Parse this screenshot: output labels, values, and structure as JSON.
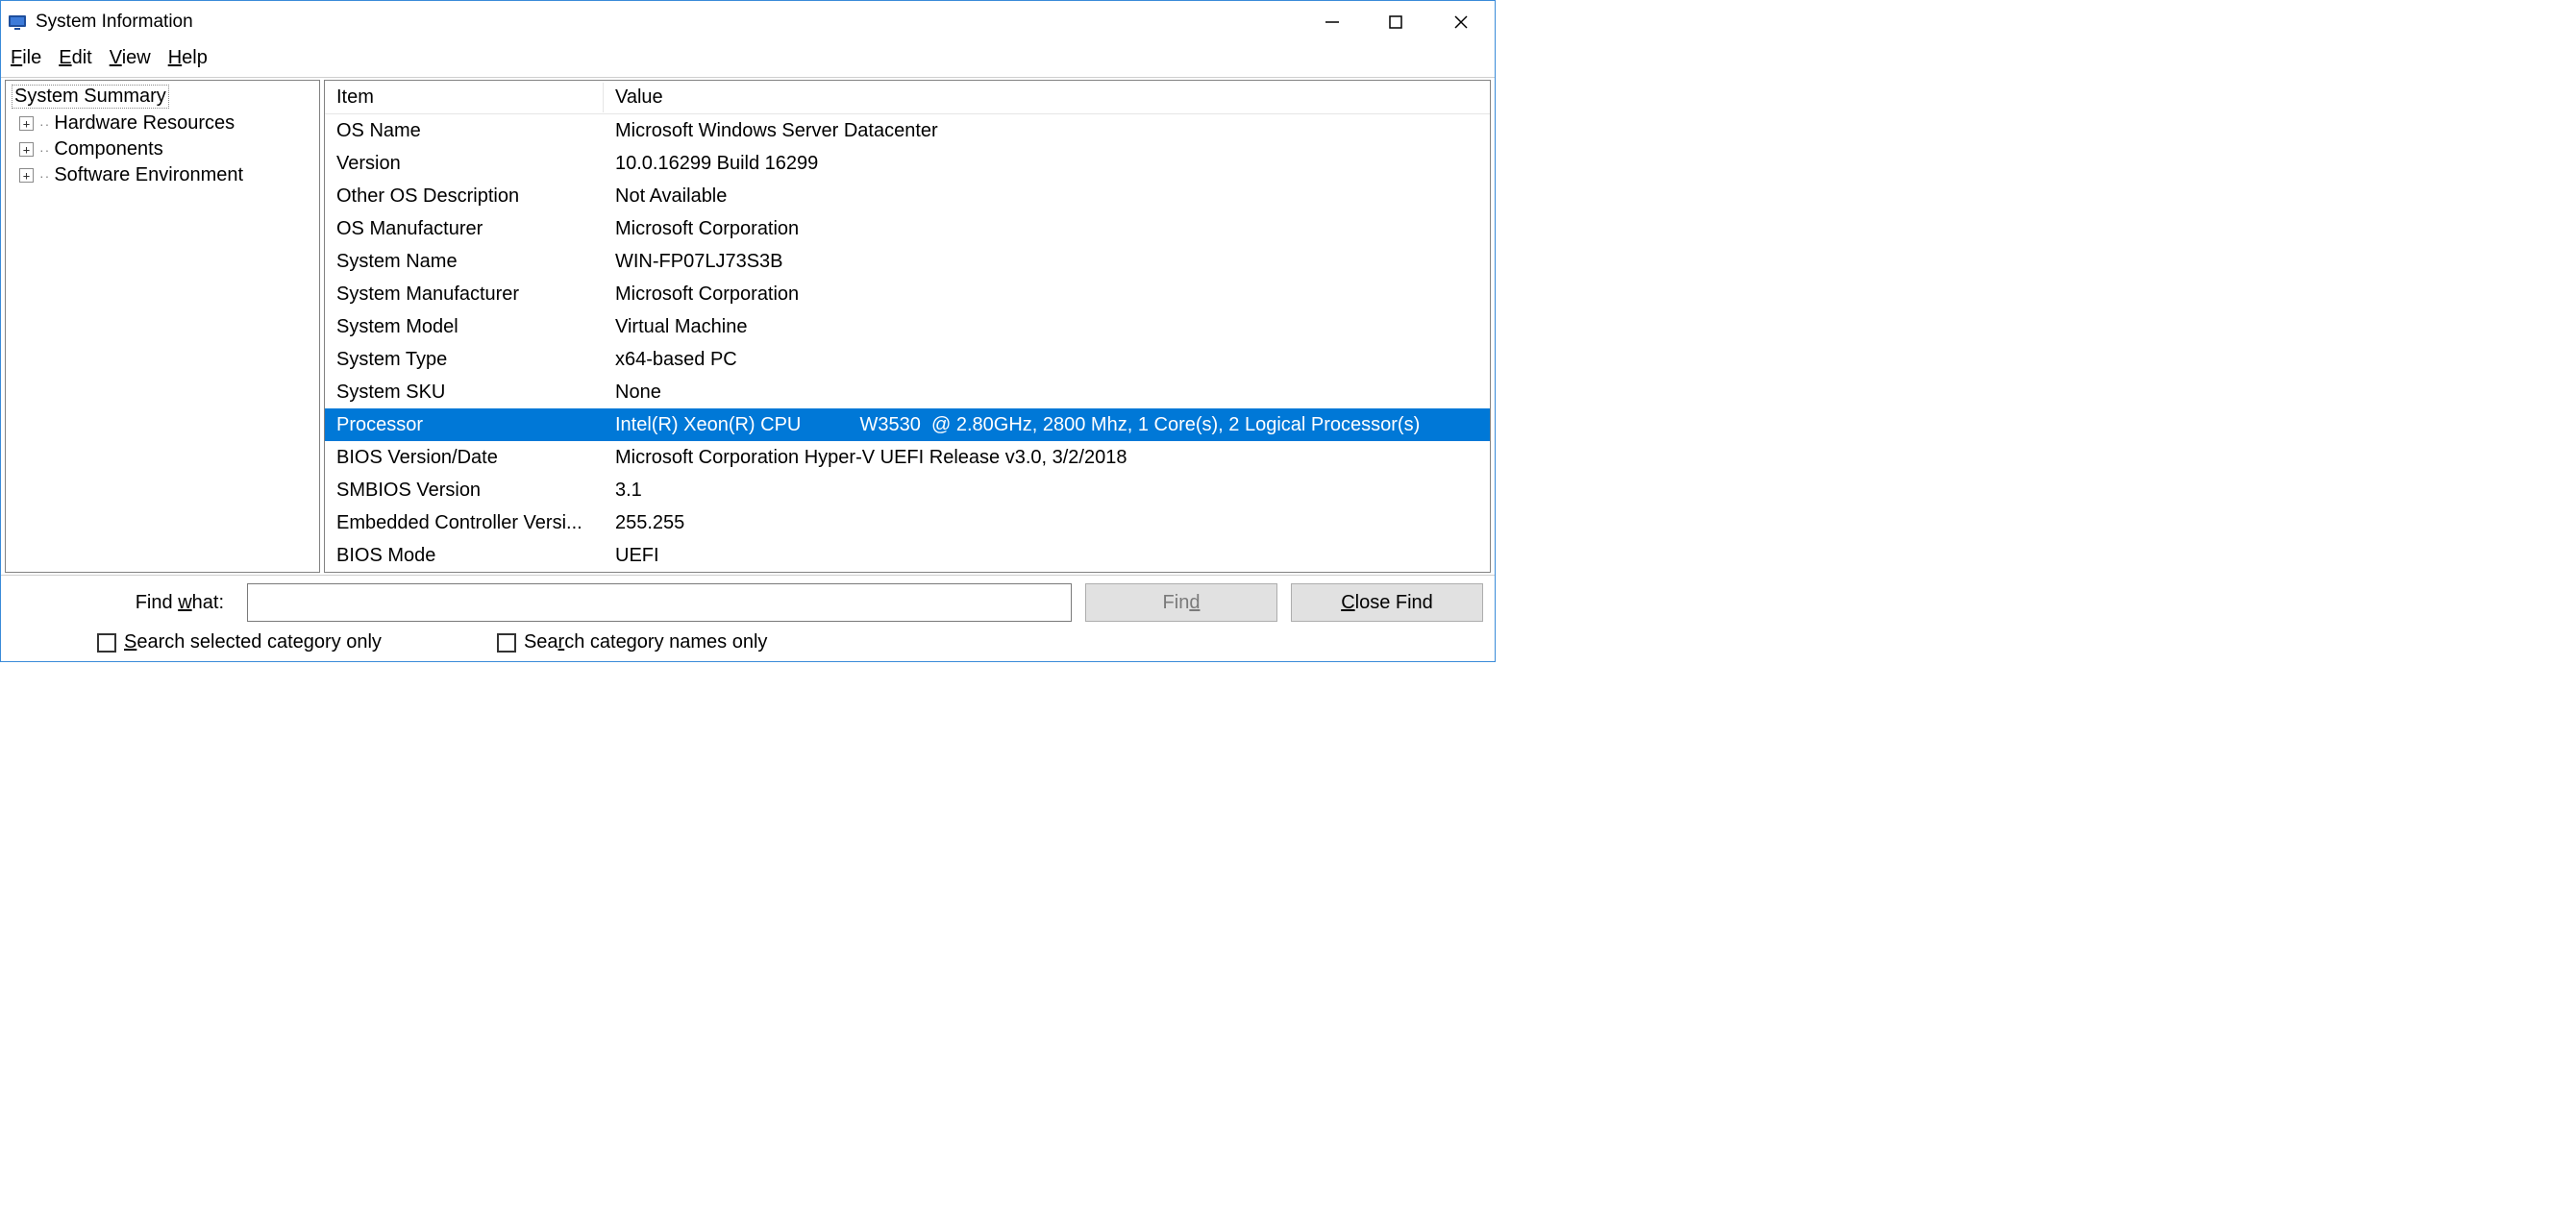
{
  "window": {
    "title": "System Information"
  },
  "menu": {
    "file": "File",
    "edit": "Edit",
    "view": "View",
    "help": "Help"
  },
  "tree": {
    "root": "System Summary",
    "children": [
      "Hardware Resources",
      "Components",
      "Software Environment"
    ]
  },
  "columns": {
    "item": "Item",
    "value": "Value"
  },
  "rows": [
    {
      "item": "OS Name",
      "value": "Microsoft Windows Server Datacenter",
      "selected": false
    },
    {
      "item": "Version",
      "value": "10.0.16299 Build 16299",
      "selected": false
    },
    {
      "item": "Other OS Description",
      "value": "Not Available",
      "selected": false
    },
    {
      "item": "OS Manufacturer",
      "value": "Microsoft Corporation",
      "selected": false
    },
    {
      "item": "System Name",
      "value": "WIN-FP07LJ73S3B",
      "selected": false
    },
    {
      "item": "System Manufacturer",
      "value": "Microsoft Corporation",
      "selected": false
    },
    {
      "item": "System Model",
      "value": "Virtual Machine",
      "selected": false
    },
    {
      "item": "System Type",
      "value": "x64-based PC",
      "selected": false
    },
    {
      "item": "System SKU",
      "value": "None",
      "selected": false
    },
    {
      "item": "Processor",
      "value": "Intel(R) Xeon(R) CPU           W3530  @ 2.80GHz, 2800 Mhz, 1 Core(s), 2 Logical Processor(s)",
      "selected": true
    },
    {
      "item": "BIOS Version/Date",
      "value": "Microsoft Corporation Hyper-V UEFI Release v3.0, 3/2/2018",
      "selected": false
    },
    {
      "item": "SMBIOS Version",
      "value": "3.1",
      "selected": false
    },
    {
      "item": "Embedded Controller Versi...",
      "value": "255.255",
      "selected": false
    },
    {
      "item": "BIOS Mode",
      "value": "UEFI",
      "selected": false
    }
  ],
  "find": {
    "label": "Find what:",
    "value": "",
    "find_button": "Find",
    "close_button": "Close Find",
    "search_selected": "Search selected category only",
    "search_names": "Search category names only"
  }
}
